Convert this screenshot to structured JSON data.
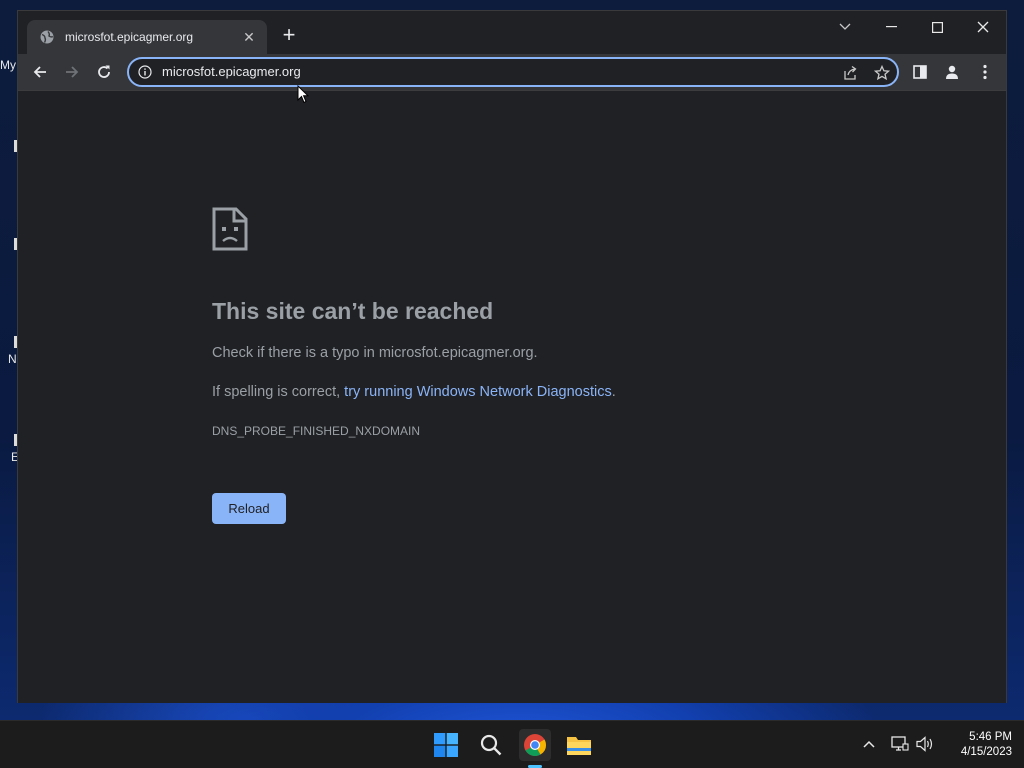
{
  "desktop": {
    "icon_labels": [
      "My",
      "N",
      "E"
    ]
  },
  "browser": {
    "tab": {
      "title": "microsfot.epicagmer.org",
      "close_glyph": "✕",
      "icon": "globe-icon"
    },
    "new_tab_glyph": "+",
    "window_controls": [
      "tab-search-icon",
      "minimize-icon",
      "maximize-icon",
      "close-icon"
    ],
    "toolbar": {
      "icons": [
        "back-arrow-icon",
        "forward-arrow-icon",
        "reload-icon",
        "side-panel-icon",
        "profile-icon",
        "menu-dots-icon"
      ]
    },
    "omnibox": {
      "value": "microsfot.epicagmer.org",
      "icons": [
        "info-icon",
        "share-icon",
        "star-icon"
      ]
    }
  },
  "error_page": {
    "title": "This site can’t be reached",
    "check_typo": "Check if there is a typo in microsfot.epicagmer.org.",
    "spelling_prefix": "If spelling is correct, ",
    "diagnostics_link": "try running Windows Network Diagnostics",
    "spelling_suffix": ".",
    "error_code": "DNS_PROBE_FINISHED_NXDOMAIN",
    "reload_label": "Reload"
  },
  "taskbar": {
    "icons": [
      "windows-start-icon",
      "search-icon",
      "chrome-icon",
      "file-explorer-icon"
    ],
    "tray_icons": [
      "chevron-up-icon",
      "network-icon",
      "volume-icon"
    ],
    "time": "5:46 PM",
    "date": "4/15/2023"
  },
  "colors": {
    "accent_link": "#8ab4f8",
    "page_bg": "#202124",
    "toolbar_bg": "#35363a",
    "taskbar_active": "#4cc2ff"
  }
}
